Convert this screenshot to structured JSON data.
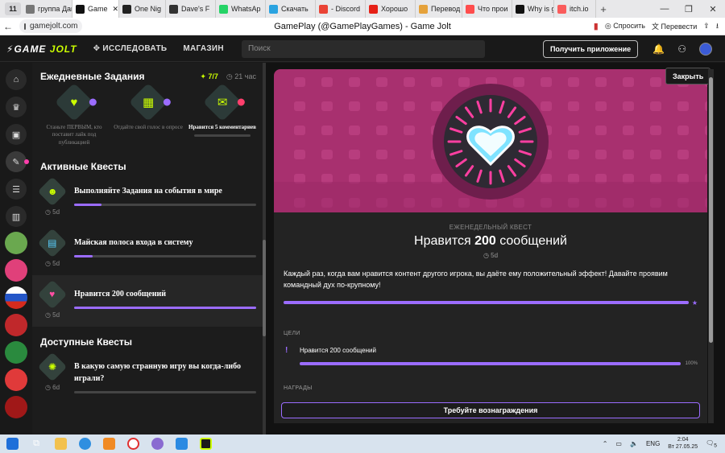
{
  "browser": {
    "tab_count": "11",
    "tabs": [
      {
        "label": "группа Дамира",
        "color": "#777"
      },
      {
        "label": "Game",
        "color": "#111",
        "active": true
      },
      {
        "label": "One Nig",
        "color": "#222"
      },
      {
        "label": "Dave's F",
        "color": "#333"
      },
      {
        "label": "WhatsAp",
        "color": "#25d366"
      },
      {
        "label": "Скачать",
        "color": "#2aa3e0"
      },
      {
        "label": "- Discord",
        "color": "#ea4335"
      },
      {
        "label": "Хорошо",
        "color": "#e62117"
      },
      {
        "label": "Перевод",
        "color": "#e5a23b"
      },
      {
        "label": "Что прои",
        "color": "#ff4d4d"
      },
      {
        "label": "Why is g",
        "color": "#111"
      },
      {
        "label": "itch.io",
        "color": "#fa5c5c"
      }
    ],
    "url": "gamejolt.com",
    "page_title": "GamePlay (@GamePlayGames) - Game Jolt",
    "ask_label": "Спросить",
    "translate_label": "Перевести"
  },
  "header": {
    "logo_game": "GAME",
    "logo_jolt": "JOLT",
    "explore": "ИССЛЕДОВАТЬ",
    "store": "МАГАЗИН",
    "search_placeholder": "Поиск",
    "get_app": "Получить приложение"
  },
  "daily": {
    "title": "Ежедневные Задания",
    "count": "7/7",
    "hours": "21 час",
    "items": [
      {
        "text": "Станьте ПЕРВЫМ, кто поставит лайк под публикацией",
        "active": false
      },
      {
        "text": "Отдайте свой голос в опросе",
        "active": false
      },
      {
        "text": "Нравится 5 комментариев",
        "active": true
      }
    ]
  },
  "active": {
    "title": "Активные Квесты",
    "items": [
      {
        "title": "Выполняйте Задания на события в мире",
        "days": "5d",
        "progress": 0.15
      },
      {
        "title": "Майская полоса входа в систему",
        "days": "5d",
        "progress": 0.1
      },
      {
        "title": "Нравится 200 сообщений",
        "days": "5d",
        "progress": 1.0,
        "selected": true
      }
    ]
  },
  "available": {
    "title": "Доступные Квесты",
    "items": [
      {
        "title": "В какую самую странную игру вы когда-либо играли?",
        "days": "6d",
        "progress": 0
      }
    ]
  },
  "modal": {
    "close": "Закрыть",
    "type": "ЕЖЕНЕДЕЛЬНЫЙ КВЕСТ",
    "title_pre": "Нравится ",
    "title_num": "200",
    "title_post": " сообщений",
    "days": "5d",
    "description": "Каждый раз, когда вам нравится контент другого игрока, вы даёте ему положительный эффект! Давайте проявим командный дух по-крупному!",
    "progress": 1.0,
    "goals_label": "ЦЕЛИ",
    "goal": "Нравится 200 сообщений",
    "goal_percent": "100%",
    "rewards_label": "НАГРАДЫ",
    "claim": "Требуйте вознаграждения"
  },
  "taskbar": {
    "lang": "ENG",
    "time": "2:04",
    "date": "Вт 27.05.25",
    "notif": "5"
  }
}
